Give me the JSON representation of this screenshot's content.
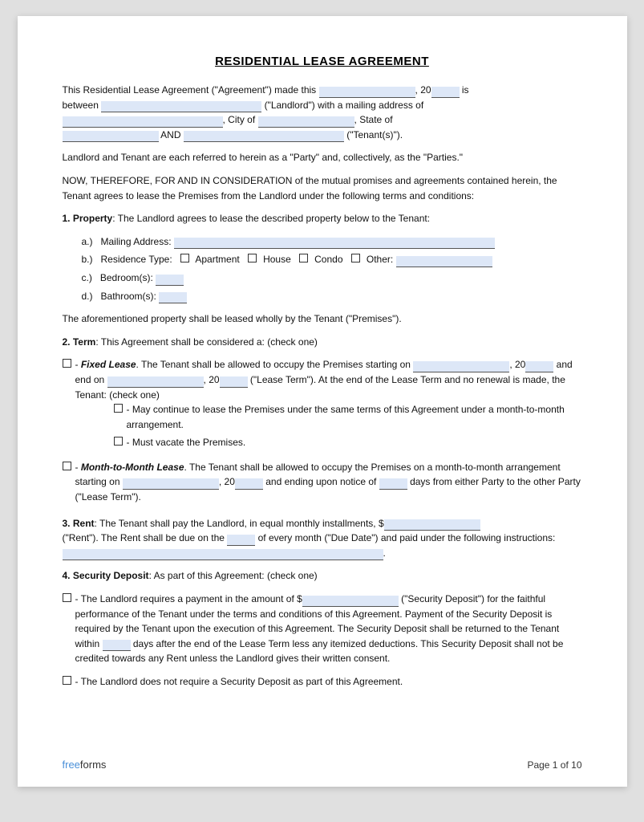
{
  "title": "RESIDENTIAL LEASE AGREEMENT",
  "intro": {
    "line1": "This Residential Lease Agreement (\"Agreement\") made this",
    "year_prefix": ", 20",
    "year_suffix": " is",
    "line2_prefix": "between",
    "landlord_suffix": "(\"Landlord\") with a mailing address of",
    "city_prefix": ", City of",
    "state_suffix": ", State of",
    "and_label": "AND",
    "tenant_suffix": "(\"Tenant(s)\")."
  },
  "paragraph1": "Landlord and Tenant are each referred to herein as a \"Party\" and, collectively, as the \"Parties.\"",
  "paragraph2": "NOW, THEREFORE, FOR AND IN CONSIDERATION of the mutual promises and agreements contained herein, the Tenant agrees to lease the Premises from the Landlord under the following terms and conditions:",
  "section1": {
    "label": "1.",
    "title": "Property",
    "text": ": The Landlord agrees to lease the described property below to the Tenant:",
    "items": [
      {
        "label": "a.)",
        "text": "Mailing Address:"
      },
      {
        "label": "b.)",
        "text": "Residence Type:",
        "checkboxes": [
          "Apartment",
          "House",
          "Condo",
          "Other:"
        ]
      },
      {
        "label": "c.)",
        "text": "Bedroom(s):"
      },
      {
        "label": "d.)",
        "text": "Bathroom(s):"
      }
    ],
    "footer": "The aforementioned property shall be leased wholly by the Tenant (\"Premises\")."
  },
  "section2": {
    "label": "2.",
    "title": "Term",
    "text": ": This Agreement shall be considered a: (check one)",
    "option1": {
      "type": "Fixed Lease",
      "desc1": ". The Tenant shall be allowed to occupy the Premises starting on",
      "desc2": ", 20",
      "desc3": "and end on",
      "desc4": ", 20",
      "desc5": "(\"Lease Term\"). At the end of the Lease Term and no renewal is made, the Tenant: (check one)",
      "sub1": "- May continue to lease the Premises under the same terms of this Agreement under a month-to-month arrangement.",
      "sub2": "- Must vacate the Premises."
    },
    "option2": {
      "type": "Month-to-Month Lease",
      "desc1": ". The Tenant shall be allowed to occupy the Premises on a month-to-month arrangement starting on",
      "desc2": ", 20",
      "desc3": "and ending upon notice of",
      "desc4": "days from either Party to the other Party (\"Lease Term\")."
    }
  },
  "section3": {
    "label": "3.",
    "title": "Rent",
    "text1": ": The Tenant shall pay the Landlord, in equal monthly installments, $",
    "text2": "(\"Rent\"). The Rent shall be due on the",
    "text3": "of every month (\"Due Date\") and paid under the following instructions:"
  },
  "section4": {
    "label": "4.",
    "title": "Security Deposit",
    "text": ": As part of this Agreement: (check one)",
    "option1_text1": "- The Landlord requires a payment in the amount of $",
    "option1_text2": "(\"Security Deposit\") for the faithful performance of the Tenant under the terms and conditions of this Agreement. Payment of the Security Deposit is required by the Tenant upon the execution of this Agreement. The Security Deposit shall be returned to the Tenant within",
    "option1_text3": "days after the end of the Lease Term less any itemized deductions. This Security Deposit shall not be credited towards any Rent unless the Landlord gives their written consent.",
    "option2_text": "- The Landlord does not require a Security Deposit as part of this Agreement."
  },
  "footer": {
    "logo_free": "free",
    "logo_forms": "forms",
    "page_label": "Page 1 of 10"
  }
}
